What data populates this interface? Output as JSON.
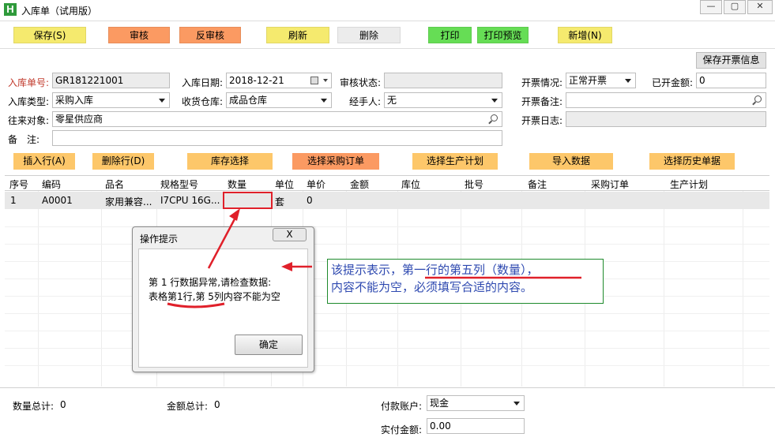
{
  "window": {
    "icon_letter": "H",
    "title": "入库单（试用版）"
  },
  "toolbar": {
    "buttons": [
      {
        "label": "保存(S)",
        "color": "#f5ea6e"
      },
      {
        "label": "审核",
        "color": "#fb9a62"
      },
      {
        "label": "反审核",
        "color": "#fb9a62"
      },
      {
        "label": "刷新",
        "color": "#f5ea6e"
      },
      {
        "label": "删除",
        "color": "#ececec"
      },
      {
        "label": "打印",
        "color": "#66dd55"
      },
      {
        "label": "打印预览",
        "color": "#66dd55"
      },
      {
        "label": "新增(N)",
        "color": "#f5ea6e"
      }
    ]
  },
  "form": {
    "save_invoice_label": "保存开票信息",
    "order_no_label": "入库单号:",
    "order_no_value": "GR181221001",
    "date_label": "入库日期:",
    "date_value": "2018-12-21",
    "audit_label": "审核状态:",
    "audit_value": "",
    "invoice_status_label": "开票情况:",
    "invoice_status_value": "正常开票",
    "invoiced_amount_label": "已开金额:",
    "invoiced_amount_value": "0",
    "type_label": "入库类型:",
    "type_value": "采购入库",
    "warehouse_label": "收货仓库:",
    "warehouse_value": "成品仓库",
    "handler_label": "经手人:",
    "handler_value": "无",
    "invoice_note_label": "开票备注:",
    "invoice_note_value": "",
    "partner_label": "往来对象:",
    "partner_value": "零星供应商",
    "invoice_log_label": "开票日志:",
    "invoice_log_value": "",
    "remark_label": "备　注:",
    "remark_value": ""
  },
  "row_actions": [
    {
      "label": "插入行(A)",
      "color": "#fdc76a"
    },
    {
      "label": "删除行(D)",
      "color": "#fdc76a"
    },
    {
      "label": "库存选择",
      "color": "#fdc76a"
    },
    {
      "label": "选择采购订单",
      "color": "#fb9a62"
    },
    {
      "label": "选择生产计划",
      "color": "#fdc76a"
    },
    {
      "label": "导入数据",
      "color": "#fdc76a"
    },
    {
      "label": "选择历史单据",
      "color": "#fdc76a"
    }
  ],
  "grid": {
    "columns": [
      "序号",
      "编码",
      "品名",
      "规格型号",
      "数量",
      "单位",
      "单价",
      "金额",
      "库位",
      "批号",
      "备注",
      "采购订单",
      "生产计划"
    ],
    "rows": [
      [
        "1",
        "A0001",
        "家用兼容...",
        "I7CPU 16G...",
        "",
        "套",
        "0",
        "",
        "",
        "",
        "",
        "",
        ""
      ]
    ]
  },
  "footer": {
    "qty_total_label": "数量总计:",
    "qty_total_value": "0",
    "amount_total_label": "金额总计:",
    "amount_total_value": "0",
    "pay_account_label": "付款账户:",
    "pay_account_value": "现金",
    "paid_amount_label": "实付金额:",
    "paid_amount_value": "0.00"
  },
  "dialog": {
    "title": "操作提示",
    "close_label": "X",
    "line1": "第 1 行数据异常,请检查数据:",
    "line2": "表格第1行,第 5列内容不能为空",
    "ok_label": "确定"
  },
  "annotation": {
    "line1": "该提示表示，第一行的第五列（数量），",
    "line2": "内容不能为空，必须填写合适的内容。",
    "accent_color": "#e0202a"
  }
}
